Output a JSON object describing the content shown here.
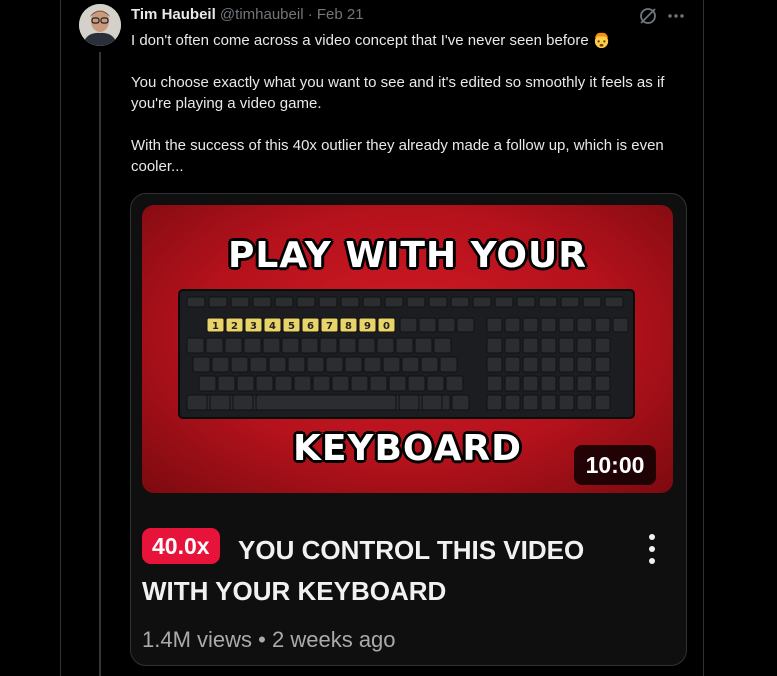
{
  "tweet": {
    "author_name": "Tim Haubeil",
    "handle": "@timhaubeil",
    "separator": "·",
    "date": "Feb 21",
    "paragraphs": [
      "I don't often come across a video concept that I've never seen before",
      "You choose exactly what you want to see and it's edited so smoothly it feels as if you're playing a video game.",
      "With the success of this 40x outlier they already made a follow up, which is even cooler..."
    ],
    "emoji_icon": "exploding-head-emoji"
  },
  "video_card": {
    "thumbnail_line1": "PLAY WITH YOUR",
    "thumbnail_line2": "KEYBOARD",
    "keyboard_number_keys": [
      "1",
      "2",
      "3",
      "4",
      "5",
      "6",
      "7",
      "8",
      "9",
      "0"
    ],
    "duration": "10:00",
    "outlier_badge": "40.0x",
    "title": "YOU CONTROL THIS VIDEO WITH YOUR KEYBOARD",
    "views": "1.4M views",
    "meta_separator": "•",
    "age": "2 weeks ago"
  },
  "icons": {
    "grok": "grok-icon",
    "more": "more-icon",
    "kebab": "kebab-menu-icon"
  },
  "colors": {
    "badge": "#e8133b",
    "thumbnail_red": "#c4141e"
  }
}
